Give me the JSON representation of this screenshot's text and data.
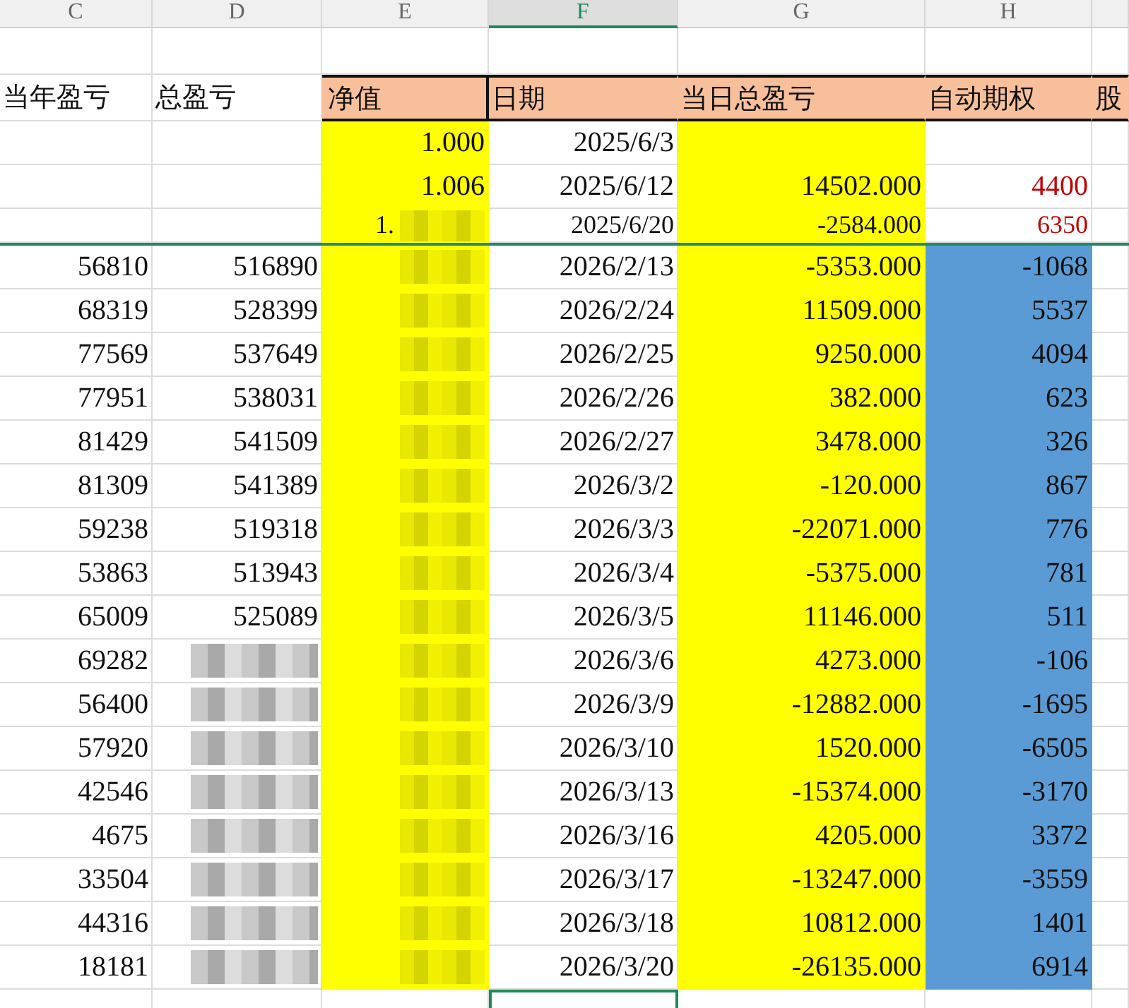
{
  "column_headers": [
    {
      "label": "C",
      "selected": false
    },
    {
      "label": "D",
      "selected": false
    },
    {
      "label": "E",
      "selected": false
    },
    {
      "label": "F",
      "selected": true
    },
    {
      "label": "G",
      "selected": false
    },
    {
      "label": "H",
      "selected": false
    }
  ],
  "header_row": [
    "当年盈亏",
    "总盈亏",
    "净值",
    "日期",
    "当日总盈亏",
    "自动期权",
    "股"
  ],
  "top_rows": [
    {
      "e": "1.000",
      "f": "2025/6/3"
    },
    {
      "e": "1.006",
      "f": "2025/6/12",
      "g": "14502.000",
      "h": "4400",
      "h_flagged": true
    },
    {
      "e": "1.",
      "e_blurred": true,
      "f": "2025/6/20",
      "g": "-2584.000",
      "h": "6350",
      "h_flagged": true
    }
  ],
  "rows": [
    {
      "c": "56810",
      "d": "516890",
      "e_blurred": true,
      "f": "2026/2/13",
      "g": "-5353.000",
      "h": "-1068"
    },
    {
      "c": "68319",
      "d": "528399",
      "e_blurred": true,
      "f": "2026/2/24",
      "g": "11509.000",
      "h": "5537"
    },
    {
      "c": "77569",
      "d": "537649",
      "e_blurred": true,
      "f": "2026/2/25",
      "g": "9250.000",
      "h": "4094"
    },
    {
      "c": "77951",
      "d": "538031",
      "e_blurred": true,
      "f": "2026/2/26",
      "g": "382.000",
      "h": "623"
    },
    {
      "c": "81429",
      "d": "541509",
      "e_blurred": true,
      "f": "2026/2/27",
      "g": "3478.000",
      "h": "326"
    },
    {
      "c": "81309",
      "d": "541389",
      "e_blurred": true,
      "f": "2026/3/2",
      "g": "-120.000",
      "h": "867"
    },
    {
      "c": "59238",
      "d": "519318",
      "e_blurred": true,
      "f": "2026/3/3",
      "g": "-22071.000",
      "h": "776"
    },
    {
      "c": "53863",
      "d": "513943",
      "e_blurred": true,
      "f": "2026/3/4",
      "g": "-5375.000",
      "h": "781"
    },
    {
      "c": "65009",
      "d": "525089",
      "e_blurred": true,
      "f": "2026/3/5",
      "g": "11146.000",
      "h": "511"
    },
    {
      "c": "69282",
      "d_blurred": true,
      "e_blurred": true,
      "f": "2026/3/6",
      "g": "4273.000",
      "h": "-106"
    },
    {
      "c": "56400",
      "d_blurred": true,
      "e_blurred": true,
      "f": "2026/3/9",
      "g": "-12882.000",
      "h": "-1695"
    },
    {
      "c": "57920",
      "d_blurred": true,
      "e_blurred": true,
      "f": "2026/3/10",
      "g": "1520.000",
      "h": "-6505"
    },
    {
      "c": "42546",
      "d_blurred": true,
      "e_blurred": true,
      "f": "2026/3/13",
      "g": "-15374.000",
      "h": "-3170"
    },
    {
      "c": "4675",
      "d_blurred": true,
      "e_blurred": true,
      "f": "2026/3/16",
      "g": "4205.000",
      "h": "3372"
    },
    {
      "c": "33504",
      "d_blurred": true,
      "e_blurred": true,
      "f": "2026/3/17",
      "g": "-13247.000",
      "h": "-3559"
    },
    {
      "c": "44316",
      "d_blurred": true,
      "e_blurred": true,
      "f": "2026/3/18",
      "g": "10812.000",
      "h": "1401"
    },
    {
      "c": "18181",
      "d_blurred": true,
      "e_blurred": true,
      "f": "2026/3/20",
      "g": "-26135.000",
      "h": "6914"
    }
  ]
}
